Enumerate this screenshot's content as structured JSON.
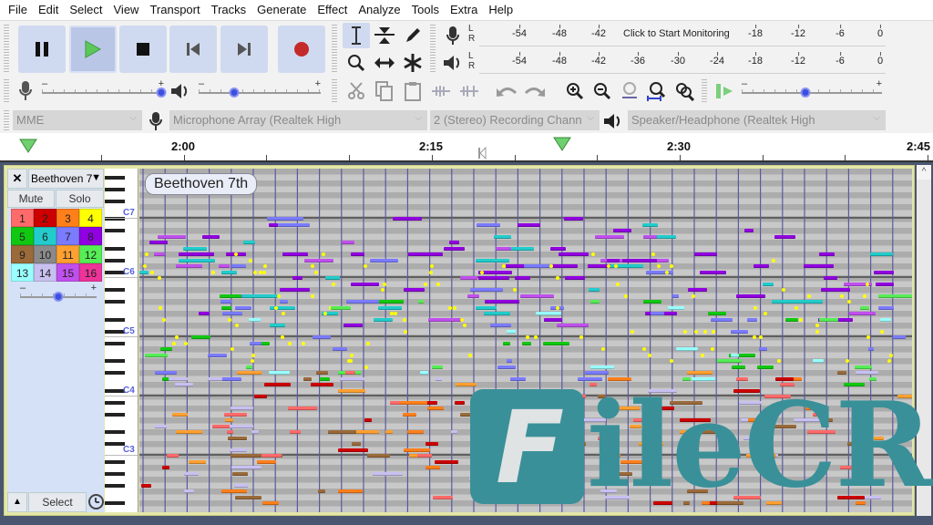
{
  "menu": [
    "File",
    "Edit",
    "Select",
    "View",
    "Transport",
    "Tracks",
    "Generate",
    "Effect",
    "Analyze",
    "Tools",
    "Extra",
    "Help"
  ],
  "transport": {
    "buttons": [
      {
        "name": "pause-button",
        "icon": "pause-icon"
      },
      {
        "name": "play-button",
        "icon": "play-icon"
      },
      {
        "name": "stop-button",
        "icon": "stop-icon"
      },
      {
        "name": "skip-to-start-button",
        "icon": "skip-start-icon"
      },
      {
        "name": "skip-to-end-button",
        "icon": "skip-end-icon"
      },
      {
        "name": "record-button",
        "icon": "record-icon"
      }
    ],
    "colors": {
      "play": "#5cc85c",
      "record": "#c42a2a"
    }
  },
  "tools": [
    "selection-tool",
    "envelope-tool",
    "draw-tool",
    "zoom-tool",
    "time-shift-tool",
    "multi-tool"
  ],
  "meters": {
    "record": {
      "ticks": [
        "-54",
        "-48",
        "-42",
        "-18",
        "-12",
        "-6",
        "0"
      ],
      "monitor_text": "Click to Start Monitoring",
      "channels": [
        "L",
        "R"
      ]
    },
    "playback": {
      "ticks": [
        "-54",
        "-48",
        "-42",
        "-36",
        "-30",
        "-24",
        "-18",
        "-12",
        "-6",
        "0"
      ],
      "channels": [
        "L",
        "R"
      ]
    }
  },
  "mixer": {
    "recording_volume": 1.0,
    "playback_volume": 0.28,
    "play_at_speed": 0.45
  },
  "devices": {
    "host": "MME",
    "recording_device": "Microphone Array (Realtek High",
    "channels": "2 (Stereo) Recording Chann",
    "playback_device": "Speaker/Headphone (Realtek High"
  },
  "timeline": {
    "labels": [
      "2:00",
      "2:15",
      "2:30",
      "2:45"
    ]
  },
  "track": {
    "name": "Beethoven 7",
    "clip_name": "Beethoven 7th",
    "mute_label": "Mute",
    "solo_label": "Solo",
    "select_label": "Select",
    "velocity": 0.5,
    "channels": [
      {
        "n": "1",
        "color": "#ff6a6a"
      },
      {
        "n": "2",
        "color": "#cc0000"
      },
      {
        "n": "3",
        "color": "#ff7f1a"
      },
      {
        "n": "4",
        "color": "#ffff00"
      },
      {
        "n": "5",
        "color": "#11c811"
      },
      {
        "n": "6",
        "color": "#22cccc"
      },
      {
        "n": "7",
        "color": "#7b7bff"
      },
      {
        "n": "8",
        "color": "#9000e0"
      },
      {
        "n": "9",
        "color": "#9a6a3a"
      },
      {
        "n": "10",
        "color": "#8a8a8a"
      },
      {
        "n": "11",
        "color": "#ffa030"
      },
      {
        "n": "12",
        "color": "#55ee55"
      },
      {
        "n": "13",
        "color": "#99ffff"
      },
      {
        "n": "14",
        "color": "#c8c0f0"
      },
      {
        "n": "15",
        "color": "#c050ee"
      },
      {
        "n": "16",
        "color": "#ee3399"
      }
    ],
    "octave_labels": [
      "C7",
      "C6",
      "C5",
      "C4",
      "C3"
    ]
  },
  "watermark": {
    "text": "ileCR",
    "letter": "F"
  }
}
